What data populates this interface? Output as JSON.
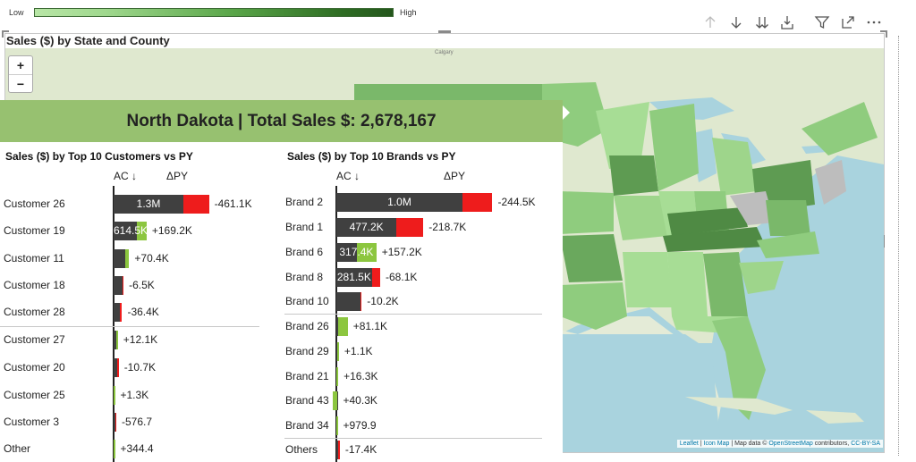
{
  "legend": {
    "low": "Low",
    "high": "High",
    "colors": [
      "#b8e6a6",
      "#24561c"
    ]
  },
  "toolbar": {
    "icons": [
      "arrow-up-icon",
      "arrow-down-icon",
      "double-arrow-down-icon",
      "expand-hierarchy-icon",
      "filter-icon",
      "focus-mode-icon",
      "more-options-icon"
    ]
  },
  "visual": {
    "title": "Sales ($) by State and County"
  },
  "map": {
    "zoom_in": "+",
    "zoom_out": "−",
    "attribution": {
      "leaflet": "Leaflet",
      "sep1": " | ",
      "iconmap": "Icon Map",
      "mid": " | Map data © ",
      "osm": "OpenStreetMap",
      "contrib": " contributors, ",
      "cc": "CC-BY-SA"
    },
    "labels": {
      "calgary": "Calgary"
    }
  },
  "tooltip": {
    "header": "North Dakota | Total Sales $: 2,678,167",
    "colors": {
      "ac": "#404040",
      "positive": "#8cc63f",
      "negative": "#ee1c1c",
      "header_bg": "#97c170"
    },
    "customers": {
      "title": "Sales ($) by Top 10 Customers vs PY",
      "ac_head": "AC ↓",
      "delta_head": "ΔPY",
      "rows": [
        {
          "label": "Customer 26",
          "ac": 1.3,
          "ac_label": "1.3M",
          "delta": -461.1,
          "delta_label": "-461.1K"
        },
        {
          "label": "Customer 19",
          "ac": 0.6145,
          "ac_label": "614.5K",
          "delta": 169.2,
          "delta_label": "+169.2K"
        },
        {
          "label": "Customer 11",
          "ac": 0.29,
          "ac_label": "",
          "delta": 70.4,
          "delta_label": "+70.4K"
        },
        {
          "label": "Customer 18",
          "ac": 0.16,
          "ac_label": "",
          "delta": -6.5,
          "delta_label": "-6.5K"
        },
        {
          "label": "Customer 28",
          "ac": 0.12,
          "ac_label": "",
          "delta": -36.4,
          "delta_label": "-36.4K"
        },
        {
          "label": "Customer 27",
          "ac": 0.08,
          "ac_label": "",
          "delta": 12.1,
          "delta_label": "+12.1K"
        },
        {
          "label": "Customer 20",
          "ac": 0.07,
          "ac_label": "",
          "delta": -10.7,
          "delta_label": "-10.7K"
        },
        {
          "label": "Customer 25",
          "ac": 0.006,
          "ac_label": "",
          "delta": 1.3,
          "delta_label": "+1.3K"
        },
        {
          "label": "Customer 3",
          "ac": 0.004,
          "ac_label": "",
          "delta": -0.5767,
          "delta_label": "-576.7"
        },
        {
          "label": "Other",
          "ac": 0.003,
          "ac_label": "",
          "delta": 0.3444,
          "delta_label": "+344.4"
        }
      ]
    },
    "brands": {
      "title": "Sales ($) by Top 10 Brands vs PY",
      "ac_head": "AC ↓",
      "delta_head": "ΔPY",
      "rows": [
        {
          "label": "Brand 2",
          "ac": 1.0,
          "ac_label": "1.0M",
          "delta": -244.5,
          "delta_label": "-244.5K"
        },
        {
          "label": "Brand 1",
          "ac": 0.4772,
          "ac_label": "477.2K",
          "delta": -218.7,
          "delta_label": "-218.7K"
        },
        {
          "label": "Brand 6",
          "ac": 0.3174,
          "ac_label": "317.4K",
          "delta": 157.2,
          "delta_label": "+157.2K"
        },
        {
          "label": "Brand 8",
          "ac": 0.2815,
          "ac_label": "281.5K",
          "delta": -68.1,
          "delta_label": "-68.1K"
        },
        {
          "label": "Brand 10",
          "ac": 0.19,
          "ac_label": "",
          "delta": -10.2,
          "delta_label": "-10.2K"
        },
        {
          "label": "Brand 26",
          "ac": 0.09,
          "ac_label": "",
          "delta": 81.1,
          "delta_label": "+81.1K"
        },
        {
          "label": "Brand 29",
          "ac": 0.02,
          "ac_label": "",
          "delta": 1.1,
          "delta_label": "+1.1K"
        },
        {
          "label": "Brand 21",
          "ac": 0.015,
          "ac_label": "",
          "delta": 16.3,
          "delta_label": "+16.3K"
        },
        {
          "label": "Brand 43",
          "ac": 0.005,
          "ac_label": "",
          "delta": 40.3,
          "delta_label": "+40.3K"
        },
        {
          "label": "Brand 34",
          "ac": 0.003,
          "ac_label": "",
          "delta": 0.9799,
          "delta_label": "+979.9"
        },
        {
          "label": "Others",
          "ac": 0.003,
          "ac_label": "",
          "delta": -17.4,
          "delta_label": "-17.4K"
        }
      ]
    }
  }
}
